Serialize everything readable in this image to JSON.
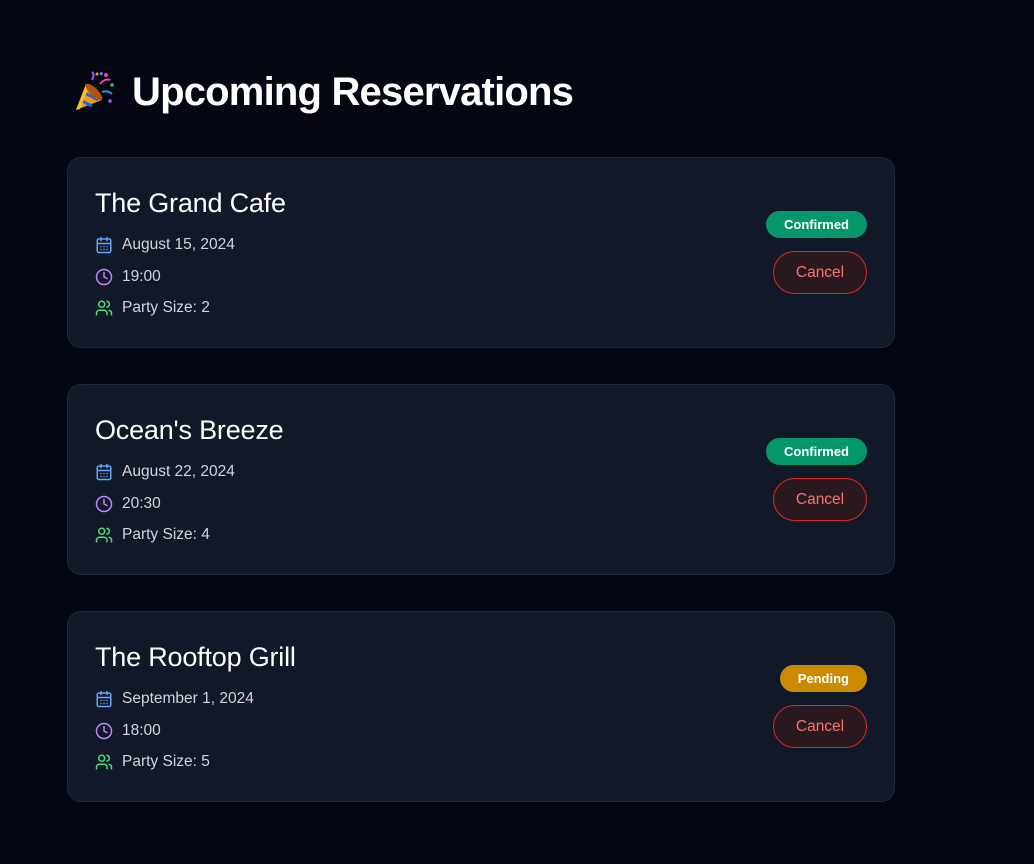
{
  "header": {
    "title": "Upcoming Reservations",
    "icon": "party-popper-icon"
  },
  "colors": {
    "background": "#030712",
    "card": "#111827",
    "confirmed": "#059669",
    "pending": "#ca8a04",
    "cancel": "#f87171",
    "calendar_icon": "#60a5fa",
    "clock_icon": "#c084fc",
    "users_icon": "#4ade80"
  },
  "reservations": [
    {
      "name": "The Grand Cafe",
      "date": "August 15, 2024",
      "time": "19:00",
      "party": "Party Size: 2",
      "status": "Confirmed",
      "status_key": "confirmed",
      "cancel_label": "Cancel"
    },
    {
      "name": "Ocean's Breeze",
      "date": "August 22, 2024",
      "time": "20:30",
      "party": "Party Size: 4",
      "status": "Confirmed",
      "status_key": "confirmed",
      "cancel_label": "Cancel"
    },
    {
      "name": "The Rooftop Grill",
      "date": "September 1, 2024",
      "time": "18:00",
      "party": "Party Size: 5",
      "status": "Pending",
      "status_key": "pending",
      "cancel_label": "Cancel"
    }
  ]
}
